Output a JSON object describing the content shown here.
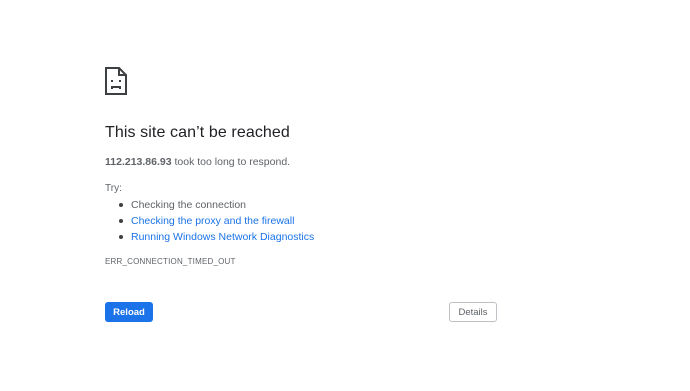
{
  "error": {
    "icon": "sad-page-icon",
    "title": "This site can’t be reached",
    "host": "112.213.86.93",
    "message": " took too long to respond.",
    "try_label": "Try:",
    "suggestions": [
      {
        "label": "Checking the connection",
        "link": false
      },
      {
        "label": "Checking the proxy and the firewall",
        "link": true
      },
      {
        "label": "Running Windows Network Diagnostics",
        "link": true
      }
    ],
    "code": "ERR_CONNECTION_TIMED_OUT"
  },
  "buttons": {
    "reload_label": "Reload",
    "details_label": "Details"
  },
  "colors": {
    "accent": "#1a73e8",
    "text": "#202124",
    "secondary_text": "#5f6368"
  }
}
